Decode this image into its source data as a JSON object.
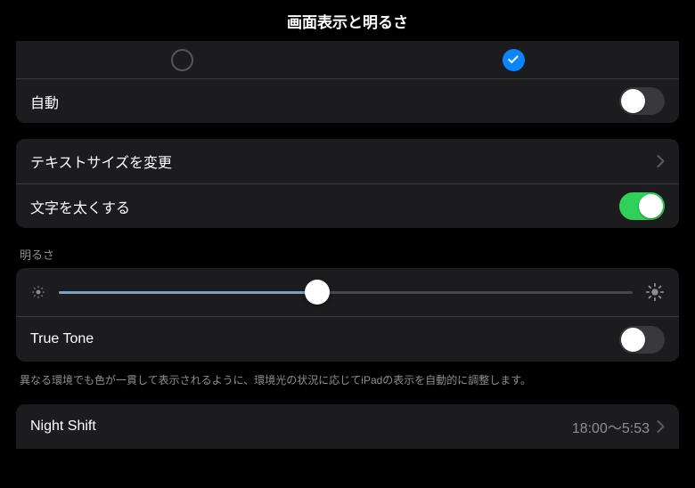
{
  "header": {
    "title": "画面表示と明るさ"
  },
  "appearance": {
    "light_selected": false,
    "dark_selected": true
  },
  "auto": {
    "label": "自動",
    "on": false
  },
  "text_section": {
    "text_size": {
      "label": "テキストサイズを変更"
    },
    "bold_text": {
      "label": "文字を太くする",
      "on": true
    }
  },
  "brightness": {
    "header": "明るさ",
    "value": 0.45,
    "true_tone": {
      "label": "True Tone",
      "on": false
    },
    "footer": "異なる環境でも色が一貫して表示されるように、環境光の状況に応じてiPadの表示を自動的に調整します。"
  },
  "night_shift": {
    "label": "Night Shift",
    "detail": "18:00～5:53"
  }
}
